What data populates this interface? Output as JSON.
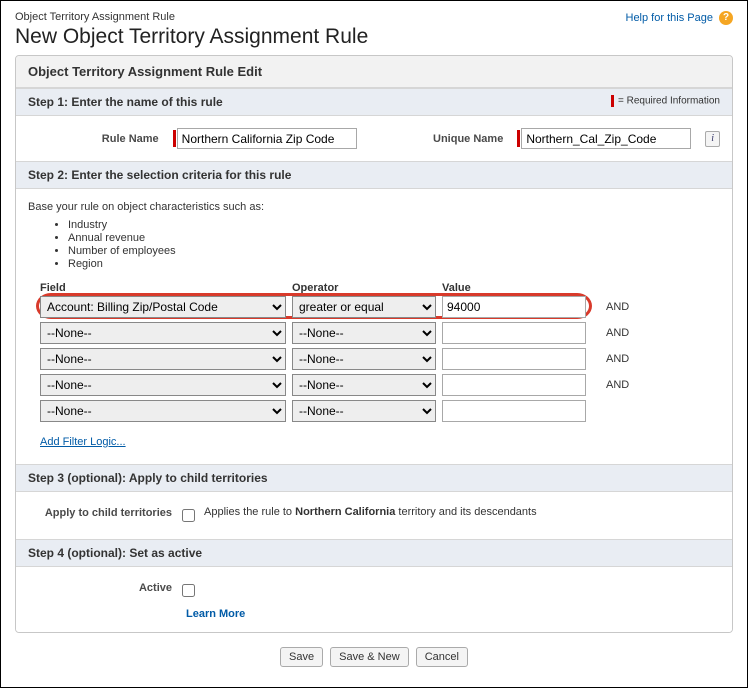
{
  "header": {
    "small_title": "Object Territory Assignment Rule",
    "main_title": "New Object Territory Assignment Rule",
    "help_text": "Help for this Page"
  },
  "panel_title": "Object Territory Assignment Rule Edit",
  "step1": {
    "header": "Step 1: Enter the name of this rule",
    "required_info": "= Required Information",
    "rule_name_label": "Rule Name",
    "rule_name_value": "Northern California Zip Code",
    "unique_name_label": "Unique Name",
    "unique_name_value": "Northern_Cal_Zip_Code"
  },
  "step2": {
    "header": "Step 2: Enter the selection criteria for this rule",
    "base_text": "Base your rule on object characteristics such as:",
    "bullets": [
      "Industry",
      "Annual revenue",
      "Number of employees",
      "Region"
    ],
    "col_field": "Field",
    "col_operator": "Operator",
    "col_value": "Value",
    "and_label": "AND",
    "rows": [
      {
        "field": "Account: Billing Zip/Postal Code",
        "operator": "greater or equal",
        "value": "94000",
        "show_and": true
      },
      {
        "field": "--None--",
        "operator": "--None--",
        "value": "",
        "show_and": true
      },
      {
        "field": "--None--",
        "operator": "--None--",
        "value": "",
        "show_and": true
      },
      {
        "field": "--None--",
        "operator": "--None--",
        "value": "",
        "show_and": true
      },
      {
        "field": "--None--",
        "operator": "--None--",
        "value": "",
        "show_and": false
      }
    ],
    "add_filter_logic": "Add Filter Logic..."
  },
  "step3": {
    "header": "Step 3 (optional): Apply to child territories",
    "label": "Apply to child territories",
    "desc_prefix": "Applies the rule to ",
    "territory_name": "Northern California",
    "desc_suffix": " territory and its descendants"
  },
  "step4": {
    "header": "Step 4 (optional): Set as active",
    "label": "Active",
    "learn_more": "Learn More"
  },
  "buttons": {
    "save": "Save",
    "save_new": "Save & New",
    "cancel": "Cancel"
  }
}
